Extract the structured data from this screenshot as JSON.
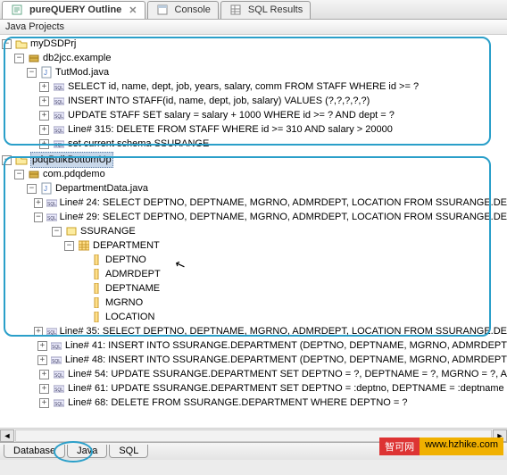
{
  "tabs": {
    "purequery": "pureQUERY Outline",
    "console": "Console",
    "sqlresults": "SQL Results"
  },
  "section_header": "Java Projects",
  "tree": {
    "proj1": {
      "name": "myDSDPrj",
      "pkg": "db2jcc.example",
      "file": "TutMod.java",
      "stmts": [
        "SELECT id, name, dept, job, years, salary, comm   FROM STAFF   WHERE id >= ?",
        "INSERT INTO STAFF(id, name, dept, job, salary)   VALUES (?,?,?,?,?)",
        "UPDATE STAFF   SET salary = salary + 1000   WHERE id >= ? AND dept = ?",
        "Line# 315: DELETE FROM STAFF   WHERE id >= 310 AND salary > 20000",
        "set current schema SSURANGE"
      ]
    },
    "proj2": {
      "name": "pdqBulkBottomUp",
      "pkg": "com.pdqdemo",
      "file": "DepartmentData.java",
      "pre": "Line# 24: SELECT DEPTNO, DEPTNAME, MGRNO, ADMRDEPT, LOCATION  FROM SSURANGE.DE",
      "open": "Line# 29: SELECT DEPTNO, DEPTNAME, MGRNO, ADMRDEPT, LOCATION  FROM SSURANGE.DE",
      "schema": "SSURANGE",
      "table": "DEPARTMENT",
      "cols": [
        "DEPTNO",
        "ADMRDEPT",
        "DEPTNAME",
        "MGRNO",
        "LOCATION"
      ],
      "post": [
        "Line# 35: SELECT DEPTNO, DEPTNAME, MGRNO, ADMRDEPT, LOCATION  FROM SSURANGE.DE",
        "Line# 41: INSERT INTO SSURANGE.DEPARTMENT (DEPTNO, DEPTNAME, MGRNO, ADMRDEPT",
        "Line# 48: INSERT INTO SSURANGE.DEPARTMENT (DEPTNO, DEPTNAME, MGRNO, ADMRDEPT",
        "Line# 54: UPDATE SSURANGE.DEPARTMENT  SET DEPTNO = ?, DEPTNAME = ?, MGRNO = ?, A",
        "Line# 61: UPDATE SSURANGE.DEPARTMENT  SET DEPTNO = :deptno, DEPTNAME = :deptname",
        "Line# 68: DELETE FROM SSURANGE.DEPARTMENT WHERE DEPTNO  = ?"
      ]
    }
  },
  "bottom_tabs": {
    "database": "Database",
    "java": "Java",
    "sql": "SQL"
  },
  "watermark": {
    "a": "智可网",
    "b": "www.hzhike.com"
  }
}
